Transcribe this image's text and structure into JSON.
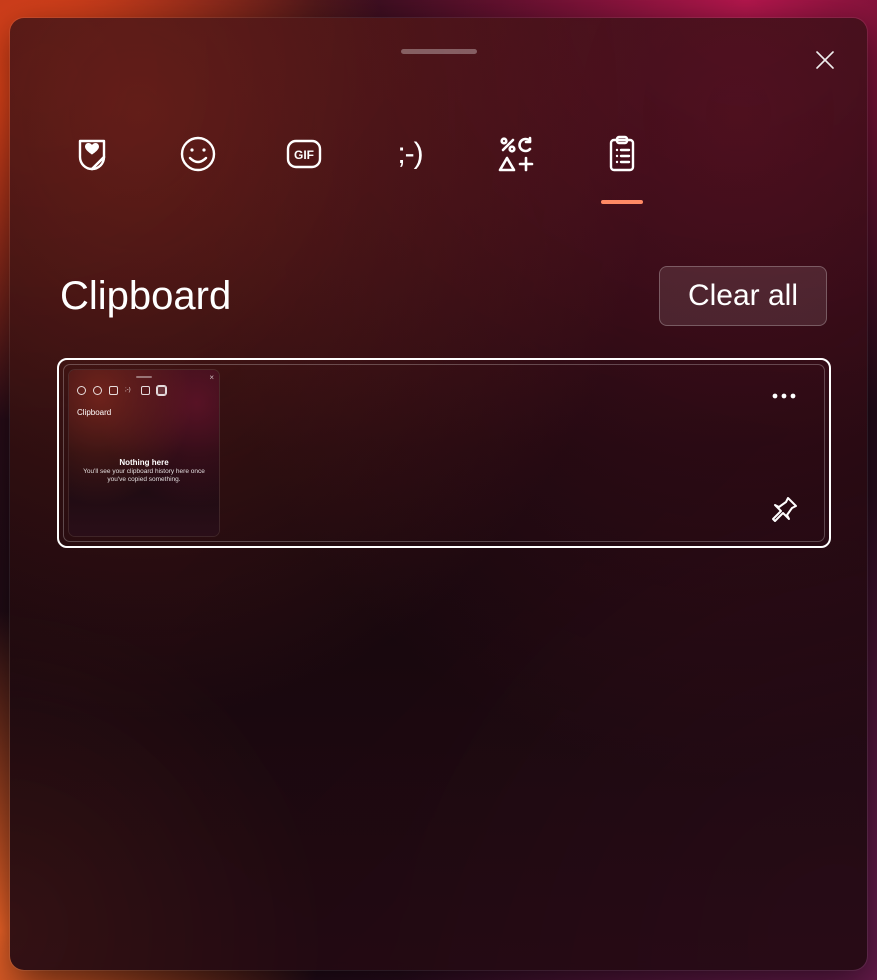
{
  "header": {
    "section_title": "Clipboard",
    "clear_all_label": "Clear all"
  },
  "tabs": {
    "stickers": "stickers",
    "emoji": "emoji",
    "gif": "gif",
    "kaomoji_face": ";-)",
    "symbols": "symbols",
    "clipboard": "clipboard",
    "active": "clipboard"
  },
  "thumb": {
    "title": "Clipboard",
    "headline": "Nothing here",
    "sub": "You'll see your clipboard history here once you've copied something."
  },
  "colors": {
    "accent": "#ff8a65"
  }
}
